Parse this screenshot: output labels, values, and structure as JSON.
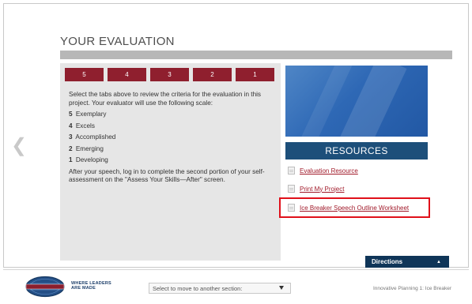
{
  "title": "YOUR EVALUATION",
  "tabs": [
    "5",
    "4",
    "3",
    "2",
    "1"
  ],
  "panel": {
    "intro": "Select the tabs above to review the criteria for the evaluation in this project. Your evaluator will use the following scale:",
    "scale": [
      {
        "num": "5",
        "label": "Exemplary"
      },
      {
        "num": "4",
        "label": "Excels"
      },
      {
        "num": "3",
        "label": "Accomplished"
      },
      {
        "num": "2",
        "label": "Emerging"
      },
      {
        "num": "1",
        "label": "Developing"
      }
    ],
    "after": "After your speech, log in to complete the second portion of your self-assessment on the \"Assess Your Skills—After\" screen."
  },
  "resources": {
    "heading": "RESOURCES",
    "links": [
      "Evaluation Resource",
      "Print My Project",
      "Ice Breaker Speech Outline Worksheet"
    ]
  },
  "nav": {
    "prev": "❮"
  },
  "directions": {
    "label": "Directions",
    "caret": "▲"
  },
  "footer": {
    "tagline_1": "WHERE LEADERS",
    "tagline_2": "ARE MADE",
    "select_placeholder": "Select to move to another section:",
    "right_text": "Innovative Planning 1: Ice Breaker"
  },
  "colors": {
    "tab": "#8f1f2e",
    "resources_header": "#1d4f7a",
    "link": "#a11a2a",
    "highlight": "#e0101a",
    "directions": "#0f3558"
  }
}
